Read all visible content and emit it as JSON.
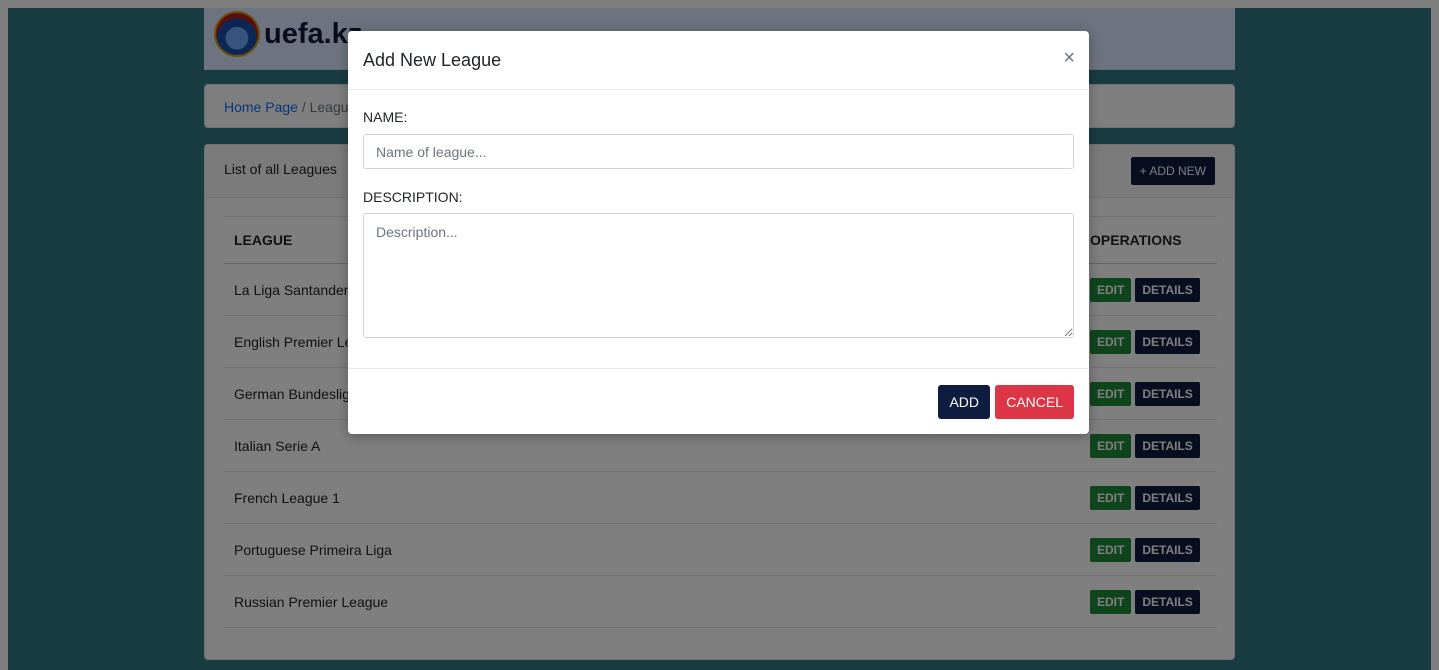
{
  "site": {
    "logo_text": "uefa.kz"
  },
  "breadcrumb": {
    "home": "Home Page",
    "separator": "/",
    "current": "Leagues"
  },
  "list": {
    "title": "List of all Leagues",
    "add_new_label": "+ ADD NEW",
    "columns": {
      "league": "LEAGUE",
      "operations": "OPERATIONS"
    },
    "rows": [
      {
        "name": "La Liga Santander"
      },
      {
        "name": "English Premier League"
      },
      {
        "name": "German Bundesliga"
      },
      {
        "name": "Italian Serie A"
      },
      {
        "name": "French League 1"
      },
      {
        "name": "Portuguese Primeira Liga"
      },
      {
        "name": "Russian Premier League"
      }
    ],
    "edit_label": "EDIT",
    "details_label": "DETAILS"
  },
  "modal": {
    "title": "Add New League",
    "close_glyph": "×",
    "name_label": "NAME:",
    "name_placeholder": "Name of league...",
    "description_label": "DESCRIPTION:",
    "description_placeholder": "Description...",
    "add_label": "ADD",
    "cancel_label": "CANCEL"
  },
  "colors": {
    "primary_dark": "#0e1d3f",
    "edit_green": "#1f8a3a",
    "cancel_red": "#dc3545",
    "page_background": "#337684"
  }
}
